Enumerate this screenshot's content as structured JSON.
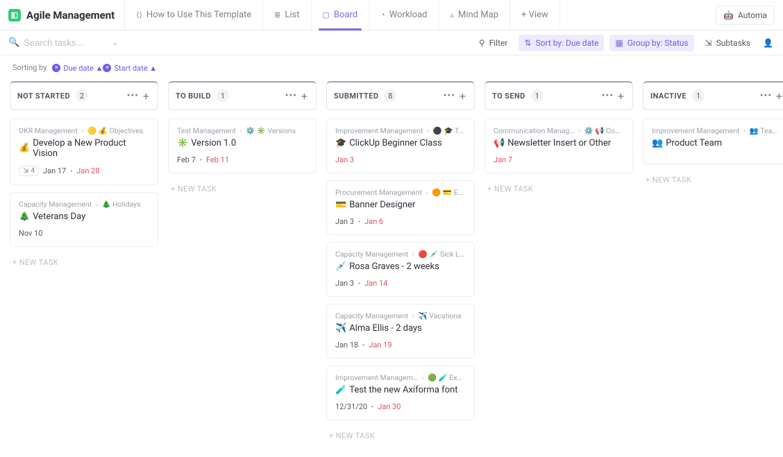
{
  "header": {
    "space_name": "Agile Management",
    "views": [
      "How to Use This Template",
      "List",
      "Board",
      "Workload",
      "Mind Map"
    ],
    "active_view": "Board",
    "add_view": "+ View",
    "automations": "Automa"
  },
  "subbar": {
    "search_placeholder": "Search tasks...",
    "filter": "Filter",
    "sort": "Sort by: Due date",
    "group": "Group by: Status",
    "subtasks": "Subtasks"
  },
  "sorting": {
    "label": "Sorting by",
    "chips": [
      "Due date ▲",
      "Start date ▲"
    ]
  },
  "new_task_label": "+ NEW TASK",
  "columns": [
    {
      "title": "NOT STARTED",
      "count": "2",
      "cards": [
        {
          "path_left": "OKR Management",
          "path_right": "Objectives",
          "path_icons": "🟡 💰",
          "title_icon": "💰",
          "title": "Develop a New Product Vision",
          "subtask_count": "4",
          "date_left": "Jan 17",
          "date_right": "Jan 28",
          "right_red": true
        },
        {
          "path_left": "Capacity Management",
          "path_right": "Holidays",
          "path_icons": "🎄",
          "title_icon": "🎄",
          "title": "Veterans Day",
          "date_left": "Nov 10",
          "date_right": "",
          "right_red": false
        }
      ]
    },
    {
      "title": "TO BUILD",
      "count": "1",
      "cards": [
        {
          "path_left": "Test Management",
          "path_right": "Versions",
          "path_icons": "⚙️ ✳️",
          "title_icon": "✳️",
          "title": "Version 1.0",
          "date_left": "Feb 7",
          "date_right": "Feb 11",
          "right_red": true
        }
      ]
    },
    {
      "title": "SUBMITTED",
      "count": "8",
      "cards": [
        {
          "path_left": "Improvement Management",
          "path_right": "Trainings",
          "path_icons": "⚫ 🎓",
          "title_icon": "🎓",
          "title": "ClickUp Beginner Class",
          "date_left": "Jan 3",
          "date_right": "",
          "right_red": false,
          "left_red": true
        },
        {
          "path_left": "Procurement Management",
          "path_right": "Expenses",
          "path_icons": "🟠 💳",
          "title_icon": "💳",
          "title": "Banner Designer",
          "date_left": "Jan 3",
          "date_right": "Jan 6",
          "right_red": true
        },
        {
          "path_left": "Capacity Management",
          "path_right": "Sick Leave",
          "path_icons": "🔴 💉",
          "title_icon": "💉",
          "title": "Rosa Graves - 2 weeks",
          "date_left": "Jan 3",
          "date_right": "Jan 14",
          "right_red": true
        },
        {
          "path_left": "Capacity Management",
          "path_right": "Vacations",
          "path_icons": "✈️",
          "title_icon": "✈️",
          "title": "Alma Ellis - 2 days",
          "date_left": "Jan 18",
          "date_right": "Jan 19",
          "right_red": true
        },
        {
          "path_left": "Improvement Managem…",
          "path_right": "Experime…",
          "path_icons": "🟢 🧪",
          "title_icon": "🧪",
          "title": "Test the new Axiforma font",
          "date_left": "12/31/20",
          "date_right": "Jan 30",
          "right_red": true
        }
      ]
    },
    {
      "title": "TO SEND",
      "count": "1",
      "cards": [
        {
          "path_left": "Communication Manag…",
          "path_right": "Communica…",
          "path_icons": "⚙️ 📢",
          "title_icon": "📢",
          "title": "Newsletter Insert or Other",
          "date_left": "Jan 7",
          "date_right": "",
          "right_red": false,
          "left_red": true
        }
      ]
    },
    {
      "title": "INACTIVE",
      "count": "1",
      "cards": [
        {
          "path_left": "Improvement Management",
          "path_right": "Team Status",
          "path_icons": "👥",
          "title_icon": "👥",
          "title": "Product Team",
          "date_left": "",
          "date_right": "",
          "right_red": false
        }
      ]
    }
  ]
}
